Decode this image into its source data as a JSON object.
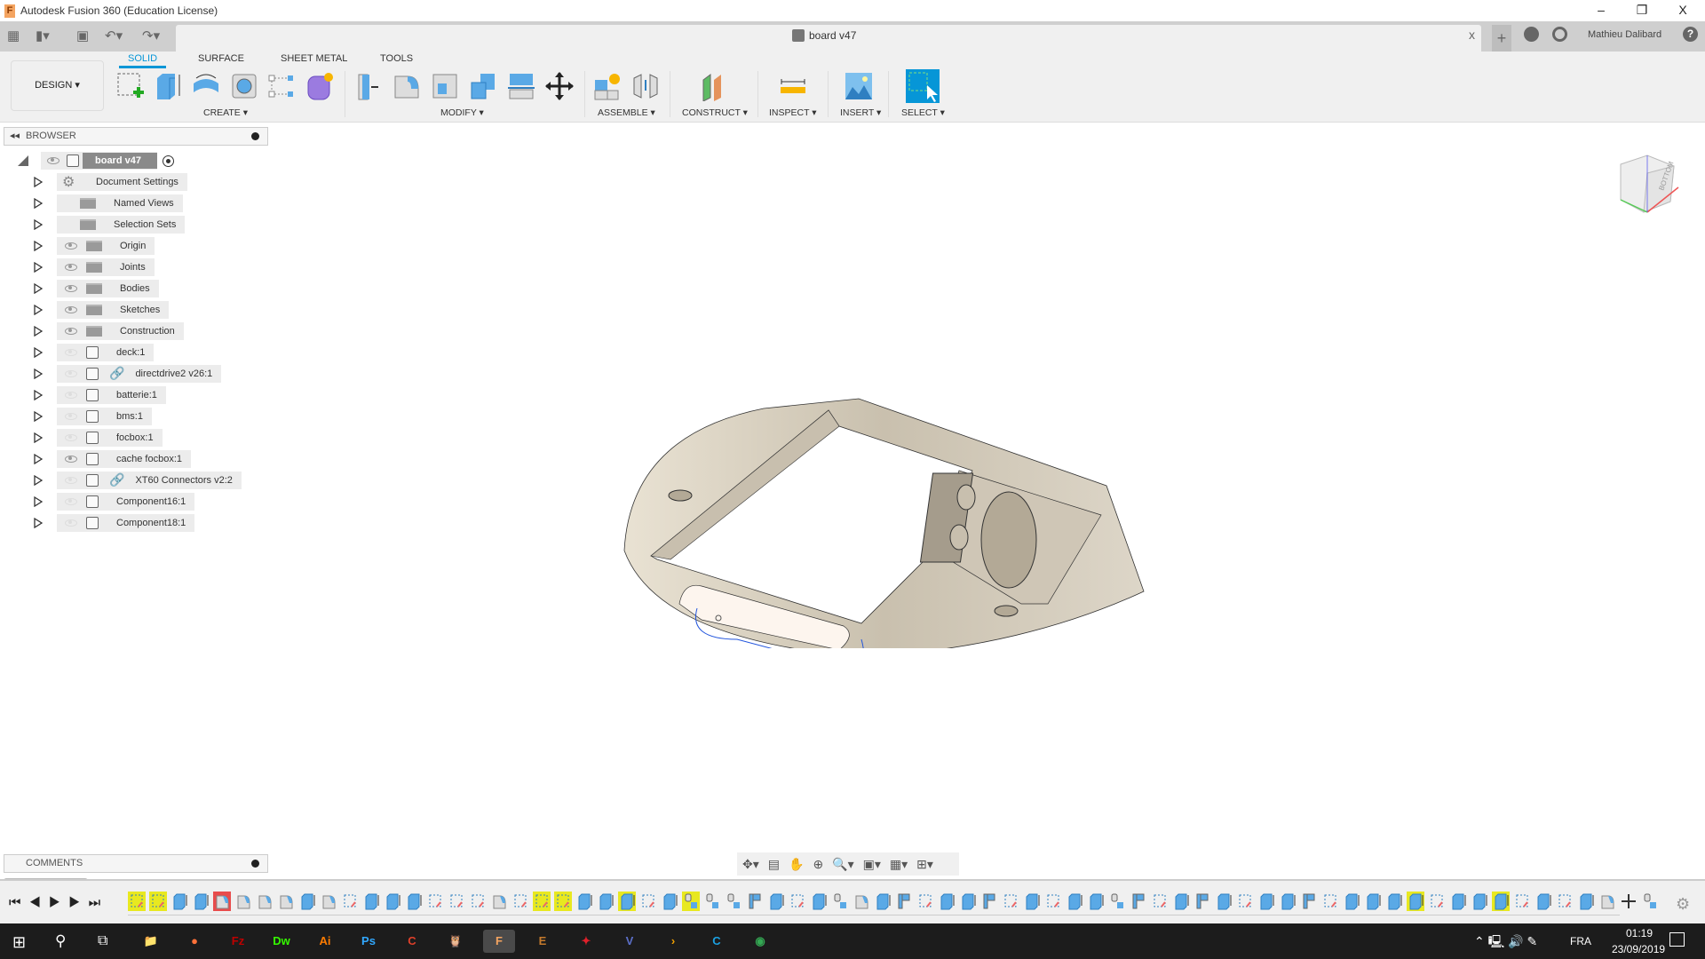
{
  "window": {
    "title": "Autodesk Fusion 360 (Education License)",
    "min": "–",
    "restore": "❐",
    "close": "X"
  },
  "qat": {
    "doc_tab": "board v47",
    "close_tab": "x",
    "new_tab": "+",
    "user": "Mathieu Dalibard",
    "help": "?"
  },
  "ribbon": {
    "workspace": "DESIGN ▾",
    "tabs": [
      {
        "label": "SOLID",
        "active": true
      },
      {
        "label": "SURFACE"
      },
      {
        "label": "SHEET METAL"
      },
      {
        "label": "TOOLS"
      }
    ],
    "groups": [
      {
        "label": "CREATE ▾"
      },
      {
        "label": "MODIFY ▾"
      },
      {
        "label": "ASSEMBLE ▾"
      },
      {
        "label": "CONSTRUCT ▾"
      },
      {
        "label": "INSPECT ▾"
      },
      {
        "label": "INSERT ▾"
      },
      {
        "label": "SELECT ▾"
      }
    ]
  },
  "browser": {
    "title": "BROWSER",
    "root": "board v47",
    "items": [
      {
        "label": "Document Settings",
        "icon": "gear-icon"
      },
      {
        "label": "Named Views",
        "icon": "folder-icon"
      },
      {
        "label": "Selection Sets",
        "icon": "folder-icon"
      },
      {
        "label": "Origin",
        "icon": "folder-icon",
        "visible": true
      },
      {
        "label": "Joints",
        "icon": "folder-icon",
        "visible": true
      },
      {
        "label": "Bodies",
        "icon": "folder-icon",
        "visible": true
      },
      {
        "label": "Sketches",
        "icon": "folder-icon",
        "visible": true
      },
      {
        "label": "Construction",
        "icon": "folder-icon",
        "visible": true
      },
      {
        "label": "deck:1",
        "icon": "component-icon",
        "visible": false
      },
      {
        "label": "directdrive2 v26:1",
        "icon": "component-icon",
        "linked": true,
        "visible": false
      },
      {
        "label": "batterie:1",
        "icon": "component-icon",
        "visible": false
      },
      {
        "label": "bms:1",
        "icon": "component-icon",
        "visible": false
      },
      {
        "label": "focbox:1",
        "icon": "component-icon",
        "visible": false
      },
      {
        "label": "cache focbox:1",
        "icon": "component-icon",
        "visible": true
      },
      {
        "label": "XT60 Connectors v2:2",
        "icon": "component-icon",
        "linked": true,
        "visible": false
      },
      {
        "label": "Component16:1",
        "icon": "component-icon",
        "visible": false
      },
      {
        "label": "Component18:1",
        "icon": "component-icon",
        "visible": false
      }
    ]
  },
  "viewcube": {
    "face": "BOTTOM"
  },
  "comments": {
    "title": "COMMENTS"
  },
  "timeline": {
    "items": "SSEEFCFFEFSXEESSSFSSSEEESXHHJPWSEHFWPSWEPSESWXHPSEPESEWPSEEEESEEESESEFMH",
    "highlighted": [
      0,
      1,
      19,
      20,
      23,
      26,
      60,
      64
    ],
    "error": [
      4
    ]
  },
  "taskbar": {
    "lang": "FRA",
    "time": "01:19",
    "date": "23/09/2019",
    "apps": [
      {
        "t": "📁",
        "c": "#f5c242"
      },
      {
        "t": "●",
        "c": "#ff7139"
      },
      {
        "t": "Fz",
        "c": "#bf0000"
      },
      {
        "t": "Dw",
        "c": "#35fa00"
      },
      {
        "t": "Ai",
        "c": "#ff7c00"
      },
      {
        "t": "Ps",
        "c": "#31a8ff"
      },
      {
        "t": "C",
        "c": "#e0402a"
      },
      {
        "t": "🦉",
        "c": "#8a9a50"
      },
      {
        "t": "F",
        "c": "#f4a460"
      },
      {
        "t": "E",
        "c": "#c57a2c"
      },
      {
        "t": "✦",
        "c": "#e0202a"
      },
      {
        "t": "V",
        "c": "#5b6fc8"
      },
      {
        "t": "›",
        "c": "#f0a000"
      },
      {
        "t": "C",
        "c": "#1ba1e2"
      },
      {
        "t": "◉",
        "c": "#34a853"
      }
    ]
  },
  "colors": {
    "accent": "#0696d7",
    "model": "#d8d0c0",
    "highlight": "#e8e820"
  }
}
